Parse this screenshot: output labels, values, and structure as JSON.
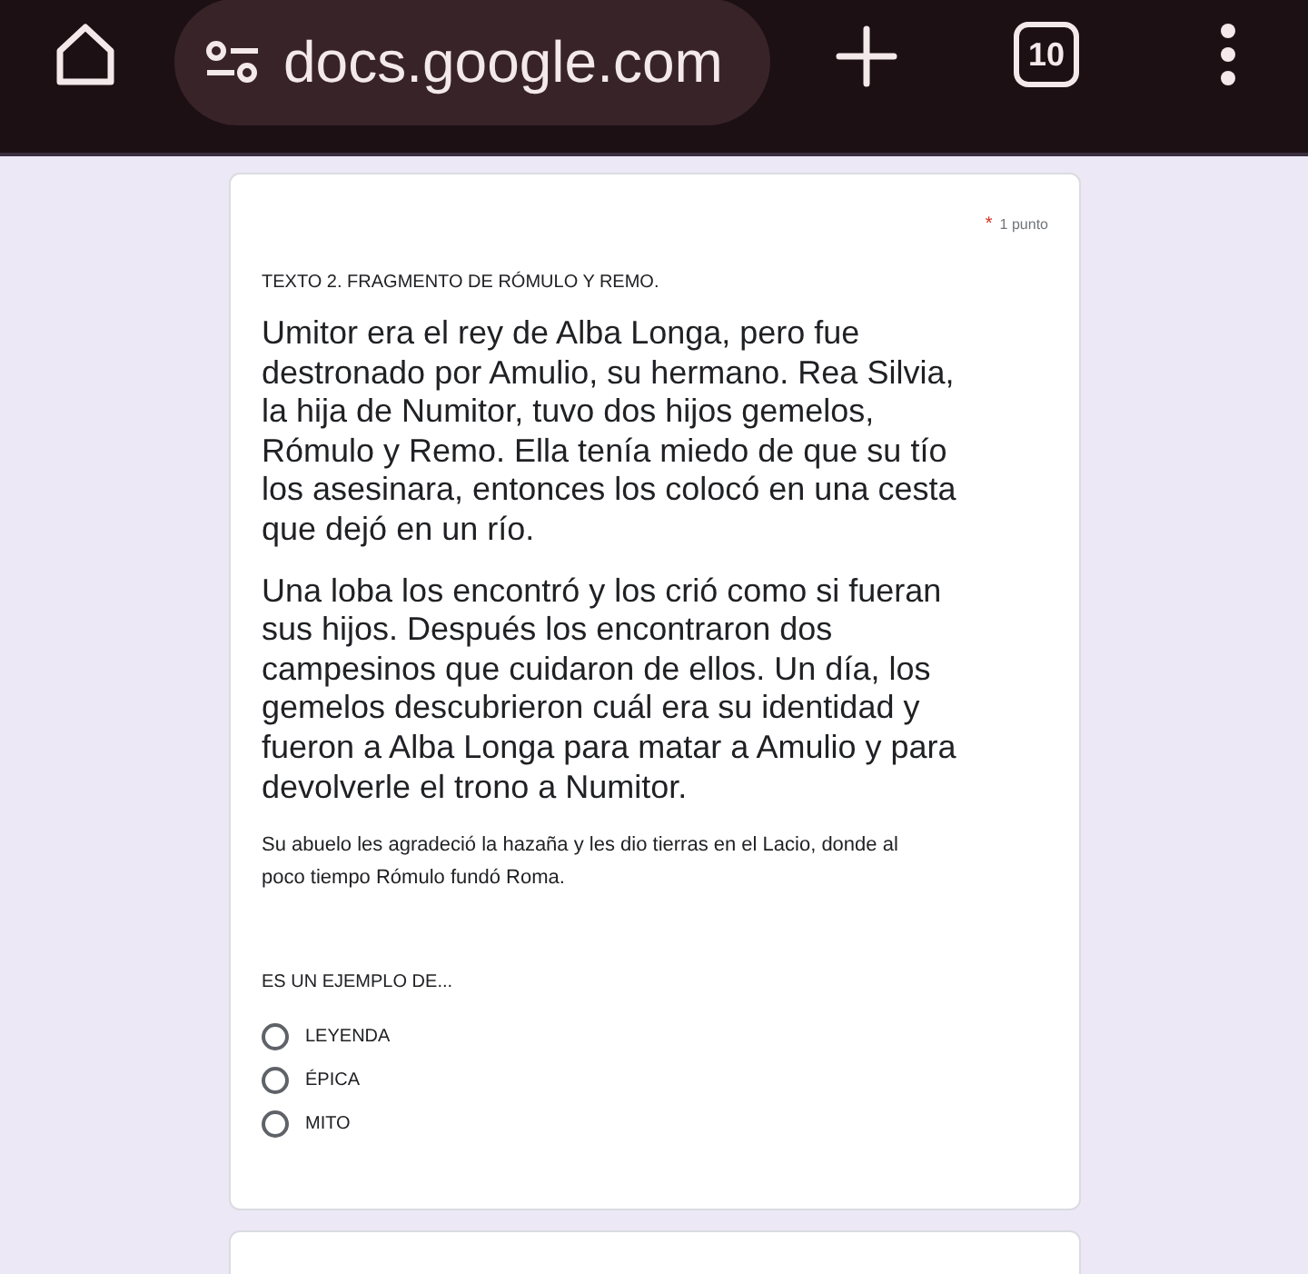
{
  "browser": {
    "url": "docs.google.com",
    "tab_count": "10"
  },
  "question": {
    "required_mark": "*",
    "points": "1 punto",
    "title": "TEXTO 2. FRAGMENTO DE RÓMULO Y REMO.",
    "paragraphs": [
      {
        "kind": "large",
        "text": "Umitor era el rey de Alba Longa, pero fue destronado por Amulio, su hermano. Rea Silvia, la hija de Numitor, tuvo dos hijos gemelos, Rómulo y Remo. Ella tenía miedo de que su tío los asesinara, entonces los colocó en una cesta que dejó en un río."
      },
      {
        "kind": "large",
        "text": "Una loba los encontró y los crió como si fueran sus hijos. Después los encontraron dos campesinos que cuidaron de ellos. Un día, los gemelos descubrieron cuál era su identidad y fueron a Alba Longa para matar a Amulio y para devolverle el trono a Numitor."
      },
      {
        "kind": "small",
        "text": "Su abuelo les agradeció la hazaña y les dio tierras en el Lacio, donde al poco tiempo Rómulo fundó Roma."
      }
    ],
    "prompt": "ES UN EJEMPLO DE...",
    "options": [
      {
        "label": "LEYENDA",
        "selected": false
      },
      {
        "label": "ÉPICA",
        "selected": false
      },
      {
        "label": "MITO",
        "selected": false
      }
    ]
  }
}
